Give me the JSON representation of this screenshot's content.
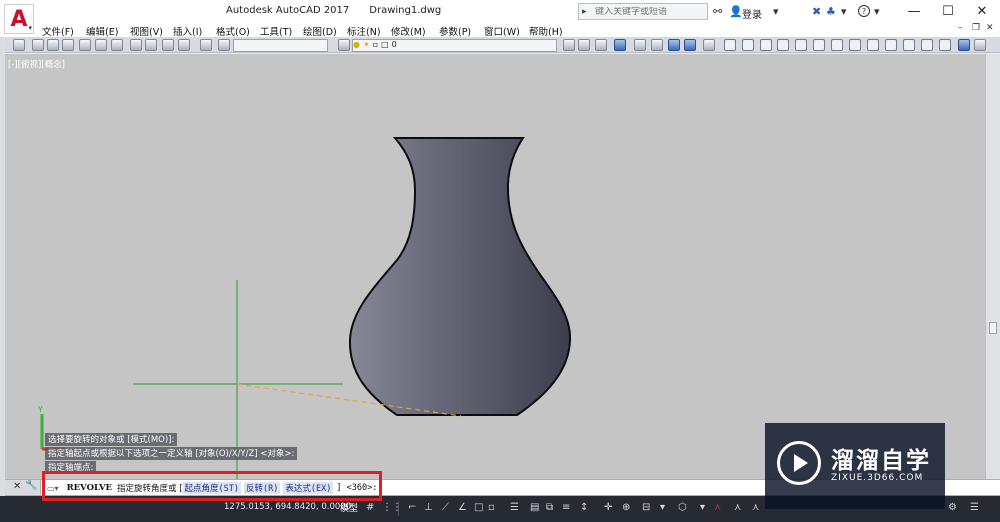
{
  "titlebar": {
    "app_title": "Autodesk AutoCAD 2017",
    "doc_title": "Drawing1.dwg",
    "search_placeholder": "键入关键字或短语",
    "login_label": "登录",
    "help_label": "?"
  },
  "app_logo_letter": "A",
  "menu": {
    "items": [
      "文件(F)",
      "编辑(E)",
      "视图(V)",
      "插入(I)",
      "格式(O)",
      "工具(T)",
      "绘图(D)",
      "标注(N)",
      "修改(M)",
      "参数(P)",
      "窗口(W)",
      "帮助(H)"
    ]
  },
  "toolbar": {
    "layer_value": "0"
  },
  "viewport": {
    "label": "[-][俯视][概念]"
  },
  "command_history": [
    "选择要旋转的对象或 [模式(MO)]:",
    "指定轴起点或根据以下选项之一定义轴 [对象(O)/X/Y/Z] <对象>:",
    "指定轴端点:"
  ],
  "command_line": {
    "command": "REVOLVE",
    "prompt": "指定旋转角度或 [",
    "options": [
      "起点角度(ST)",
      "反转(R)",
      "表达式(EX)"
    ],
    "suffix": "] <360>:"
  },
  "statusbar": {
    "coordinates": "1275.0153, 694.8420, 0.0000",
    "model_tab": "模型"
  },
  "watermark": {
    "title": "溜溜自学",
    "url": "ZIXUE.3D66.COM"
  },
  "colors": {
    "viewport_bg": "#c5c5c5",
    "crosshair": "#2e9a2e",
    "vase_dark": "#3c3e4e",
    "vase_light": "#858896",
    "axis_dash": "#e6a23c",
    "highlight_box": "#e02020",
    "statusbar_bg": "#252a33"
  }
}
